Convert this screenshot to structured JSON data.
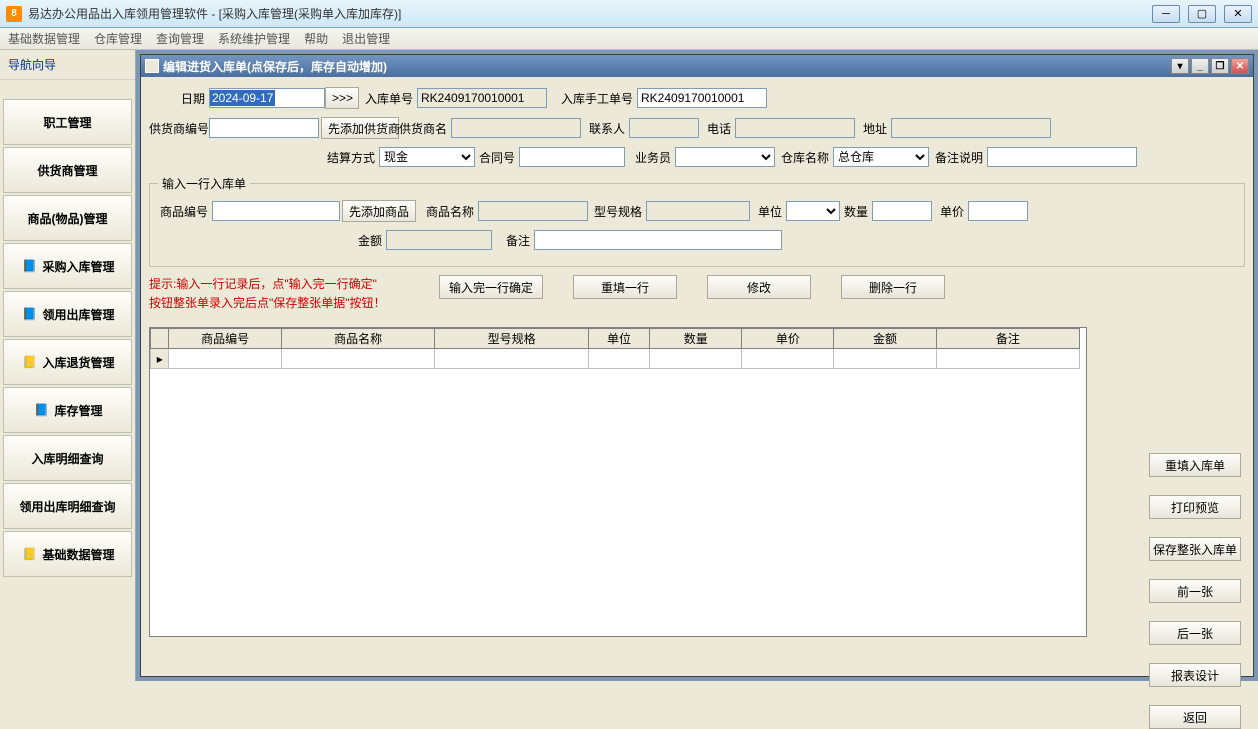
{
  "window": {
    "title": "易达办公用品出入库领用管理软件   - [采购入库管理(采购单入库加库存)]"
  },
  "menu": {
    "items": [
      "基础数据管理",
      "仓库管理",
      "查询管理",
      "系统维护管理",
      "帮助",
      "退出管理"
    ]
  },
  "sidebar": {
    "header": "导航向导",
    "items": [
      {
        "label": "职工管理",
        "icon": ""
      },
      {
        "label": "供货商管理",
        "icon": ""
      },
      {
        "label": "商品(物品)管理",
        "icon": ""
      },
      {
        "label": "采购入库管理",
        "icon": "📘"
      },
      {
        "label": "领用出库管理",
        "icon": "📘"
      },
      {
        "label": "入库退货管理",
        "icon": "📒"
      },
      {
        "label": "库存管理",
        "icon": "📘"
      },
      {
        "label": "入库明细查询",
        "icon": ""
      },
      {
        "label": "领用出库明细查询",
        "icon": ""
      },
      {
        "label": "基础数据管理",
        "icon": "📒"
      }
    ]
  },
  "inner": {
    "title": "编辑进货入库单(点保存后，库存自动增加)"
  },
  "form": {
    "date_label": "日期",
    "date_value": "2024-09-17",
    "date_btn": ">>>",
    "rkno_label": "入库单号",
    "rkno_value": "RK2409170010001",
    "manual_label": "入库手工单号",
    "manual_value": "RK2409170010001",
    "supplier_code_label": "供货商编号",
    "add_supplier_btn": "先添加供货商",
    "supplier_name_label": "供货商名",
    "contact_label": "联系人",
    "phone_label": "电话",
    "addr_label": "地址",
    "paymode_label": "结算方式",
    "paymode_value": "现金",
    "contract_label": "合同号",
    "salesman_label": "业务员",
    "warehouse_label": "仓库名称",
    "warehouse_value": "总仓库",
    "note_label": "备注说明"
  },
  "line": {
    "legend": "输入一行入库单",
    "code_label": "商品编号",
    "add_product_btn": "先添加商品",
    "name_label": "商品名称",
    "spec_label": "型号规格",
    "unit_label": "单位",
    "qty_label": "数量",
    "price_label": "单价",
    "amount_label": "金额",
    "remark_label": "备注"
  },
  "hint": {
    "l1": "提示:输入一行记录后，点\"输入完一行确定\"",
    "l2": "按钮整张单录入完后点\"保存整张单据\"按钮！"
  },
  "actions": {
    "confirm": "输入完一行确定",
    "refill": "重填一行",
    "modify": "修改",
    "delete": "删除一行"
  },
  "table": {
    "headers": [
      "商品编号",
      "商品名称",
      "型号规格",
      "单位",
      "数量",
      "单价",
      "金额",
      "备注"
    ]
  },
  "side": {
    "refill_doc": "重填入库单",
    "preview": "打印预览",
    "save_doc": "保存整张入库单",
    "prev": "前一张",
    "next": "后一张",
    "report": "报表设计",
    "back": "返回"
  }
}
